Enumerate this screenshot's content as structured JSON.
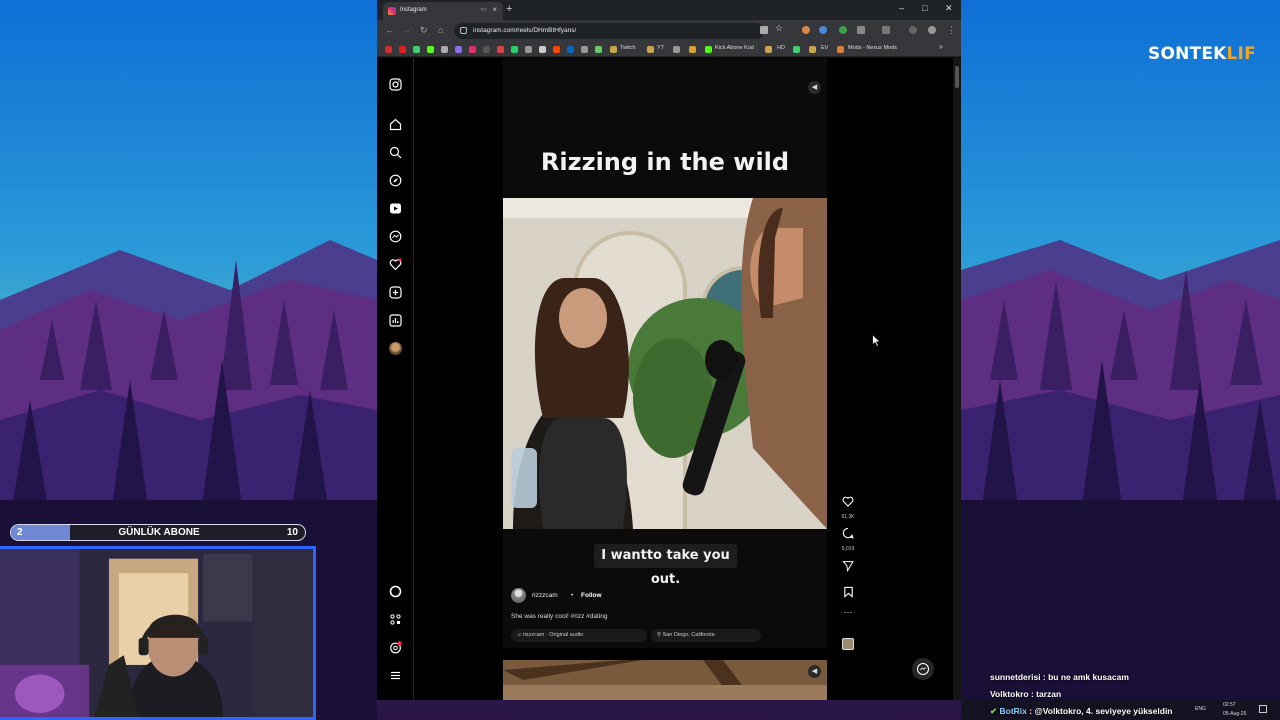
{
  "browser": {
    "tab_title": "Instagram",
    "url": "instagram.com/reels/DHmBtHfyans/",
    "new_tab_icon": "plus-icon",
    "bookmarks": [
      "Twitch",
      "YT",
      "Kick Abone Kod",
      "HD",
      "EV",
      "Mods - Nexus Mods"
    ]
  },
  "reel": {
    "title": "Rizzing in the wild",
    "subtitle": "I wantto take you out.",
    "author": "rizzzcam",
    "separator": "•",
    "follow_label": "Follow",
    "description": "She was really cool! #rizz #dating",
    "audio": "rizzzcam · Original audio",
    "location": "San Diego, California",
    "likes": "61.3K",
    "comments": "5,019"
  },
  "overlay": {
    "logo_main": "SONTEK",
    "logo_accent": "LIF",
    "sub_goal_label": "GÜNLÜK ABONE",
    "sub_current": "2",
    "sub_target": "10",
    "sub_progress": 0.2
  },
  "chat": [
    {
      "user": "sunnetderisi",
      "sep": " : ",
      "message": "bu ne amk kusacam"
    },
    {
      "user": "Volktokro",
      "sep": " : ",
      "message": "tarzan"
    },
    {
      "user": "BotRix",
      "sep": " : ",
      "message": "@Volktokro, 4. seviyeye yükseldin"
    }
  ],
  "taskbar": {
    "lang": "ENG",
    "time": "02:57",
    "date": "05-Aug-25"
  },
  "colors": {
    "instagram_bg": "#000000",
    "accent_blue": "#2e64ff",
    "logo_accent": "#f5a623"
  }
}
